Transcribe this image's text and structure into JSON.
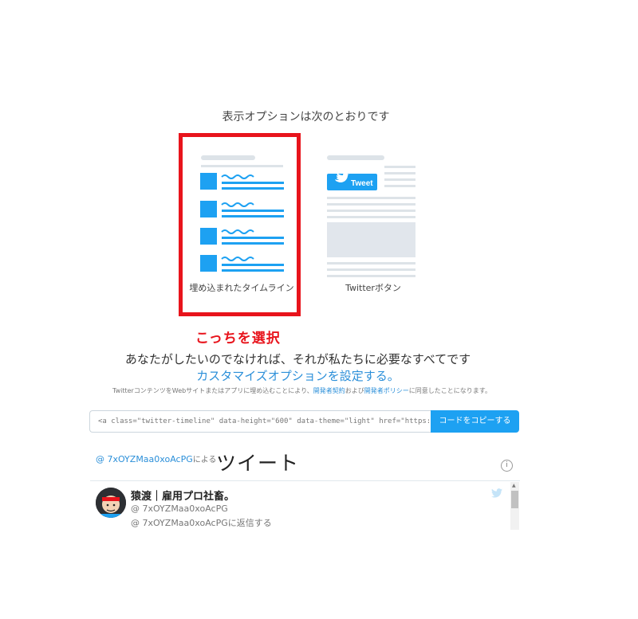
{
  "heading": "表示オプションは次のとおりです",
  "options": [
    {
      "label": "埋め込まれたタイムライン",
      "selected": true
    },
    {
      "label": "Twitterボタン",
      "selected": false,
      "button_text": "Tweet"
    }
  ],
  "select_note": "こっちを選択",
  "tagline": "あなたがしたいのでなければ、それが私たちに必要なすべてです",
  "customize_link": "カスタマイズオプションを設定する。",
  "legal": {
    "prefix": "TwitterコンテンツをWebサイトまたはアプリに埋め込むことにより、",
    "link1": "開発者契約",
    "mid": "および",
    "link2": "開発者ポリシー",
    "suffix": "に同意したことになります。"
  },
  "code_box": "<a class=\"twitter-timeline\" data-height=\"600\" data-theme=\"light\" href=\"https://twitter.com/7xOYZMaa0xoAcPG",
  "copy_button": "コードをコピーする",
  "timeline": {
    "by_handle": "@ 7xOYZMaa0xoAcPG",
    "by_suffix": "による",
    "title": "ツイート",
    "info": "i",
    "tweet": {
      "name": "猿渡｜雇用プロ社畜。",
      "handle": "@ 7xOYZMaa0xoAcPG",
      "reply": "@ 7xOYZMaa0xoAcPGに返信する"
    }
  },
  "colors": {
    "accent": "#1da1f2",
    "highlight": "#e8141c",
    "link": "#2b8fd9"
  }
}
